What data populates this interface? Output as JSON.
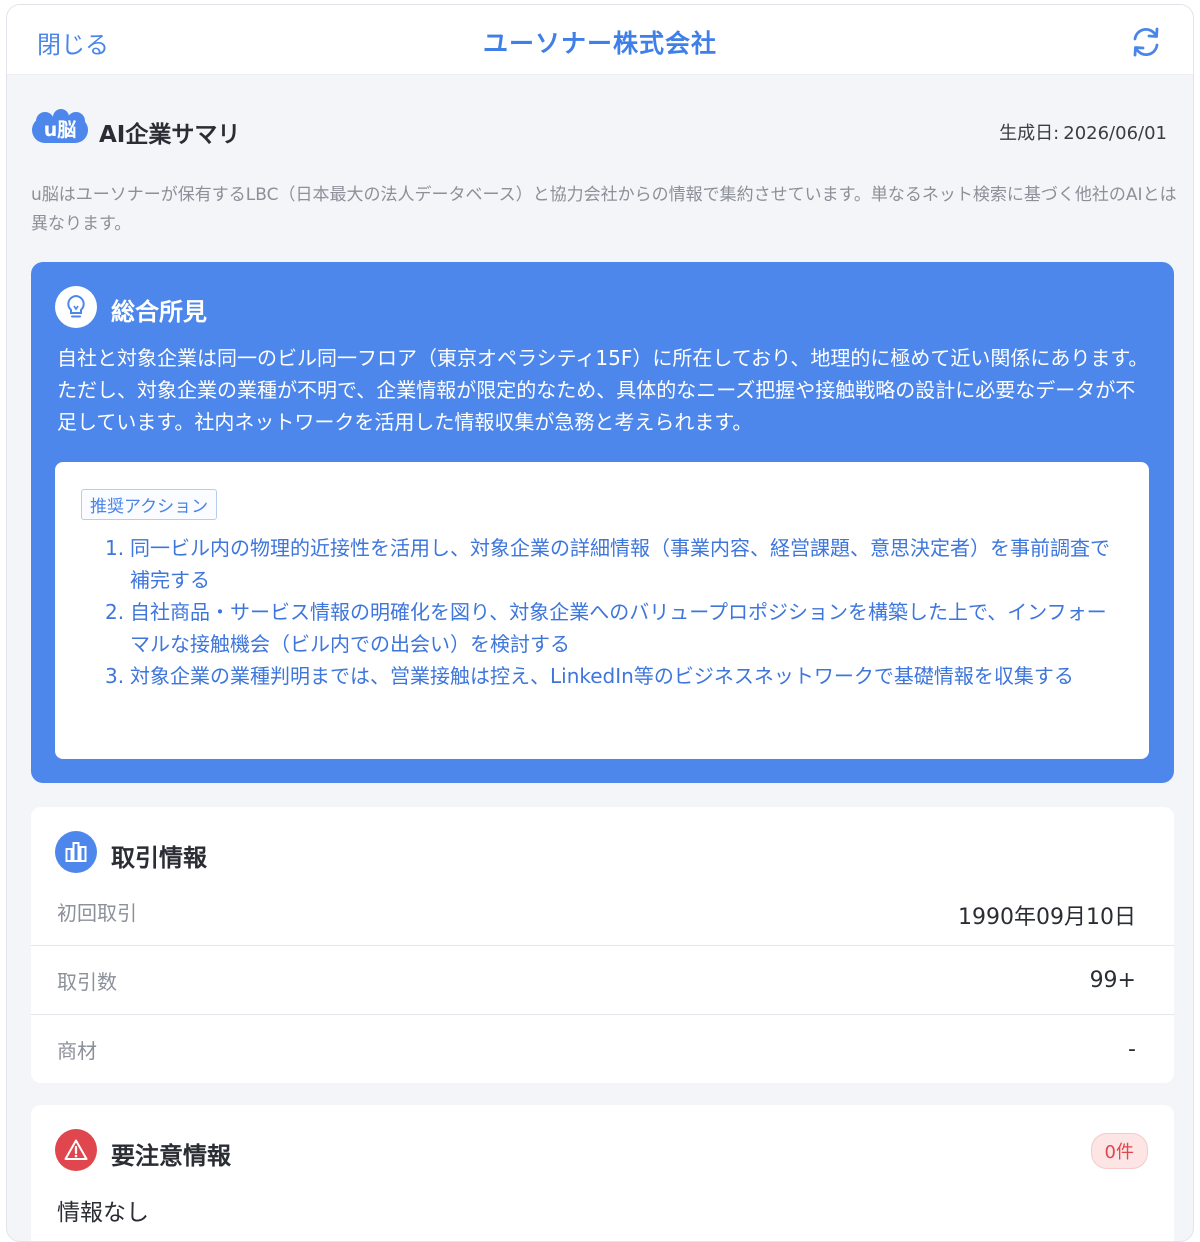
{
  "header": {
    "close_label": "閉じる",
    "title": "ユーソナー株式会社",
    "refresh_icon": "refresh-icon"
  },
  "summary": {
    "logo_text": "u脳",
    "title": "AI企業サマリ",
    "date_label": "生成日:",
    "date_value": "2026/06/01",
    "disclaimer": "u脳はユーソナーが保有するLBC（日本最大の法人データベース）と協力会社からの情報で集約させています。単なるネット検索に基づく他社のAIとは異なります。"
  },
  "insight": {
    "icon": "lightbulb-icon",
    "title": "総合所見",
    "body": "自社と対象企業は同一のビル同一フロア（東京オペラシティ15F）に所在しており、地理的に極めて近い関係にあります。ただし、対象企業の業種が不明で、企業情報が限定的なため、具体的なニーズ把握や接触戦略の設計に必要なデータが不足しています。社内ネットワークを活用した情報収集が急務と考えられます。",
    "actions_label": "推奨アクション",
    "actions": [
      {
        "num": "1.",
        "text": "同一ビル内の物理的近接性を活用し、対象企業の詳細情報（事業内容、経営課題、意思決定者）を事前調査で補完する"
      },
      {
        "num": "2.",
        "text": "自社商品・サービス情報の明確化を図り、対象企業へのバリュープロポジションを構築した上で、インフォーマルな接触機会（ビル内での出会い）を検討する"
      },
      {
        "num": "3.",
        "text": "対象企業の業種判明までは、営業接触は控え、LinkedIn等のビジネスネットワークで基礎情報を収集する"
      }
    ]
  },
  "deals": {
    "icon": "bar-chart-icon",
    "title": "取引情報",
    "rows": [
      {
        "label": "初回取引",
        "value": "1990年09月10日"
      },
      {
        "label": "取引数",
        "value": "99+"
      },
      {
        "label": "商材",
        "value": "-"
      }
    ]
  },
  "warnings": {
    "icon": "warning-icon",
    "title": "要注意情報",
    "count_badge": "0件",
    "empty_text": "情報なし"
  },
  "colors": {
    "accent": "#4d87ec",
    "link": "#3e76dc",
    "danger": "#e0464d",
    "background": "#f4f5f8"
  }
}
